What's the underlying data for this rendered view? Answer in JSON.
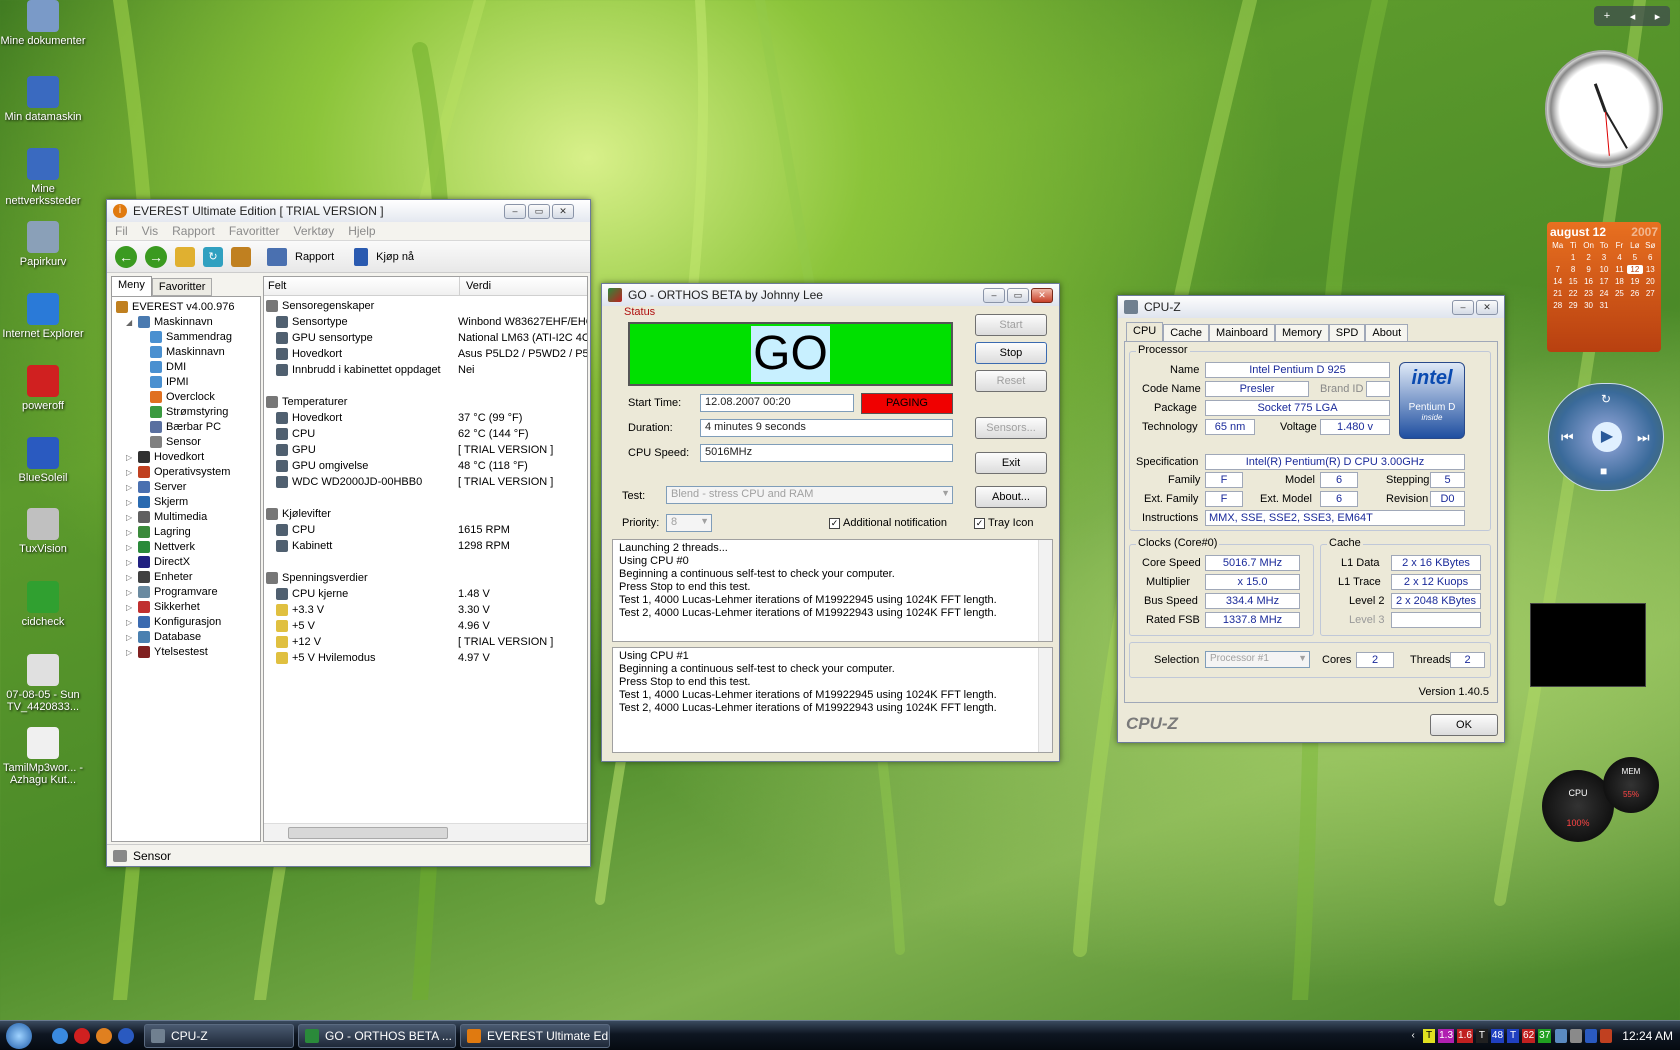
{
  "desktop": {
    "icons": [
      {
        "label": "Mine dokumenter"
      },
      {
        "label": "Min datamaskin"
      },
      {
        "label": "Mine nettverkssteder"
      },
      {
        "label": "Papirkurv"
      },
      {
        "label": "Internet Explorer"
      },
      {
        "label": "poweroff"
      },
      {
        "label": "BlueSoleil"
      },
      {
        "label": "TuxVision"
      },
      {
        "label": "cidcheck"
      },
      {
        "label": "07-08-05 - Sun TV_4420833..."
      },
      {
        "label": "TamilMp3wor... - Azhagu Kut..."
      }
    ]
  },
  "everest": {
    "title": "EVEREST Ultimate Edition  [ TRIAL VERSION ]",
    "menu": [
      "Fil",
      "Vis",
      "Rapport",
      "Favoritter",
      "Verktøy",
      "Hjelp"
    ],
    "toolbar": {
      "report": "Rapport",
      "buy": "Kjøp nå"
    },
    "tabs": [
      "Meny",
      "Favoritter"
    ],
    "tree": [
      {
        "label": "EVEREST v4.00.976",
        "lvl": 0
      },
      {
        "label": "Maskinnavn",
        "lvl": 1
      },
      {
        "label": "Sammendrag",
        "lvl": 2
      },
      {
        "label": "Maskinnavn",
        "lvl": 2
      },
      {
        "label": "DMI",
        "lvl": 2
      },
      {
        "label": "IPMI",
        "lvl": 2
      },
      {
        "label": "Overclock",
        "lvl": 2
      },
      {
        "label": "Strømstyring",
        "lvl": 2
      },
      {
        "label": "Bærbar PC",
        "lvl": 2
      },
      {
        "label": "Sensor",
        "lvl": 2
      },
      {
        "label": "Hovedkort",
        "lvl": 1
      },
      {
        "label": "Operativsystem",
        "lvl": 1
      },
      {
        "label": "Server",
        "lvl": 1
      },
      {
        "label": "Skjerm",
        "lvl": 1
      },
      {
        "label": "Multimedia",
        "lvl": 1
      },
      {
        "label": "Lagring",
        "lvl": 1
      },
      {
        "label": "Nettverk",
        "lvl": 1
      },
      {
        "label": "DirectX",
        "lvl": 1
      },
      {
        "label": "Enheter",
        "lvl": 1
      },
      {
        "label": "Programvare",
        "lvl": 1
      },
      {
        "label": "Sikkerhet",
        "lvl": 1
      },
      {
        "label": "Konfigurasjon",
        "lvl": 1
      },
      {
        "label": "Database",
        "lvl": 1
      },
      {
        "label": "Ytelsestest",
        "lvl": 1
      }
    ],
    "columns": {
      "field": "Felt",
      "value": "Verdi"
    },
    "sections": [
      {
        "title": "Sensoregenskaper",
        "rows": [
          [
            "Sensortype",
            "Winbond W83627EHF/EHG"
          ],
          [
            "GPU sensortype",
            "National LM63  (ATI-I2C 4C"
          ],
          [
            "Hovedkort",
            "Asus P5LD2 / P5WD2 / P5V"
          ],
          [
            "Innbrudd i kabinettet oppdaget",
            "Nei"
          ]
        ]
      },
      {
        "title": "Temperaturer",
        "rows": [
          [
            "Hovedkort",
            "37 °C  (99 °F)"
          ],
          [
            "CPU",
            "62 °C  (144 °F)"
          ],
          [
            "GPU",
            "[ TRIAL VERSION ]"
          ],
          [
            "GPU omgivelse",
            "48 °C  (118 °F)"
          ],
          [
            "WDC WD2000JD-00HBB0",
            "[ TRIAL VERSION ]"
          ]
        ]
      },
      {
        "title": "Kjølevifter",
        "rows": [
          [
            "CPU",
            "1615 RPM"
          ],
          [
            "Kabinett",
            "1298 RPM"
          ]
        ]
      },
      {
        "title": "Spenningsverdier",
        "rows": [
          [
            "CPU kjerne",
            "1.48 V"
          ],
          [
            "+3.3 V",
            "3.30 V"
          ],
          [
            "+5 V",
            "4.96 V"
          ],
          [
            "+12 V",
            "[ TRIAL VERSION ]"
          ],
          [
            "+5 V Hvilemodus",
            "4.97 V"
          ]
        ]
      }
    ],
    "status": "Sensor"
  },
  "orthos": {
    "title": "GO - ORTHOS BETA by Johnny Lee",
    "status_label": "Status",
    "go": "GO",
    "start_time_label": "Start Time:",
    "start_time": "12.08.2007 00:20",
    "paging": "PAGING",
    "duration_label": "Duration:",
    "duration": "4 minutes 9 seconds",
    "cpu_speed_label": "CPU Speed:",
    "cpu_speed": "5016MHz",
    "buttons": {
      "start": "Start",
      "stop": "Stop",
      "reset": "Reset",
      "sensors": "Sensors...",
      "exit": "Exit",
      "about": "About..."
    },
    "test_label": "Test:",
    "test_value": "Blend - stress CPU and RAM",
    "priority_label": "Priority:",
    "priority_value": "8",
    "additional_notification": "Additional notification",
    "tray_icon": "Tray Icon",
    "log1": [
      "Launching 2 threads...",
      "Using CPU #0",
      "Beginning a continuous self-test to check your computer.",
      "Press Stop to end this test.",
      "Test 1, 4000 Lucas-Lehmer iterations of M19922945 using 1024K FFT length.",
      "Test 2, 4000 Lucas-Lehmer iterations of M19922943 using 1024K FFT length."
    ],
    "log2": [
      "Using CPU #1",
      "Beginning a continuous self-test to check your computer.",
      "Press Stop to end this test.",
      "Test 1, 4000 Lucas-Lehmer iterations of M19922945 using 1024K FFT length.",
      "Test 2, 4000 Lucas-Lehmer iterations of M19922943 using 1024K FFT length."
    ]
  },
  "cpuz": {
    "title": "CPU-Z",
    "tabs": [
      "CPU",
      "Cache",
      "Mainboard",
      "Memory",
      "SPD",
      "About"
    ],
    "processor": {
      "group": "Processor",
      "name_label": "Name",
      "name": "Intel Pentium D 925",
      "code_label": "Code Name",
      "code": "Presler",
      "brand_label": "Brand ID",
      "package_label": "Package",
      "package": "Socket 775 LGA",
      "tech_label": "Technology",
      "tech": "65 nm",
      "voltage_label": "Voltage",
      "voltage": "1.480 v",
      "spec_label": "Specification",
      "spec": "Intel(R) Pentium(R) D CPU 3.00GHz",
      "family_label": "Family",
      "family": "F",
      "model_label": "Model",
      "model": "6",
      "stepping_label": "Stepping",
      "stepping": "5",
      "extfam_label": "Ext. Family",
      "extfam": "F",
      "extmodel_label": "Ext. Model",
      "extmodel": "6",
      "rev_label": "Revision",
      "rev": "D0",
      "instr_label": "Instructions",
      "instr": "MMX, SSE, SSE2, SSE3, EM64T"
    },
    "logo": {
      "brand": "intel",
      "product": "Pentium D",
      "inside": "inside"
    },
    "clocks": {
      "group": "Clocks (Core#0)",
      "core_label": "Core Speed",
      "core": "5016.7 MHz",
      "mult_label": "Multiplier",
      "mult": "x 15.0",
      "bus_label": "Bus Speed",
      "bus": "334.4 MHz",
      "fsb_label": "Rated FSB",
      "fsb": "1337.8 MHz"
    },
    "cache": {
      "group": "Cache",
      "l1d_label": "L1 Data",
      "l1d": "2 x 16 KBytes",
      "l1t_label": "L1 Trace",
      "l1t": "2 x 12 Kuops",
      "l2_label": "Level 2",
      "l2": "2 x 2048 KBytes",
      "l3_label": "Level 3"
    },
    "selection_label": "Selection",
    "selection": "Processor #1",
    "cores_label": "Cores",
    "cores": "2",
    "threads_label": "Threads",
    "threads": "2",
    "version": "Version 1.40.5",
    "brand": "CPU-Z",
    "ok": "OK"
  },
  "gadgets": {
    "calendar_month": "august 12",
    "calendar_year": "2007",
    "weekdays": [
      "Ma",
      "Ti",
      "On",
      "To",
      "Fr",
      "Lø",
      "Sø"
    ],
    "days": [
      "",
      "1",
      "2",
      "3",
      "4",
      "5",
      "6",
      "7",
      "8",
      "9",
      "10",
      "11",
      "12",
      "13",
      "14",
      "15",
      "16",
      "17",
      "18",
      "19",
      "20",
      "21",
      "22",
      "23",
      "24",
      "25",
      "26",
      "27",
      "28",
      "29",
      "30",
      "31",
      "",
      "",
      "",
      ""
    ],
    "meter_cpu": "CPU",
    "meter_cpu_val": "100%",
    "meter_mem": "MEM",
    "meter_mem_val": "55%"
  },
  "taskbar": {
    "items": [
      "CPU-Z",
      "GO - ORTHOS BETA ...",
      "EVEREST Ultimate Ed..."
    ],
    "clock": "12:24 AM",
    "tray": [
      "T",
      "1.3",
      "1.6",
      "T",
      "48",
      "T",
      "62",
      "37"
    ]
  }
}
